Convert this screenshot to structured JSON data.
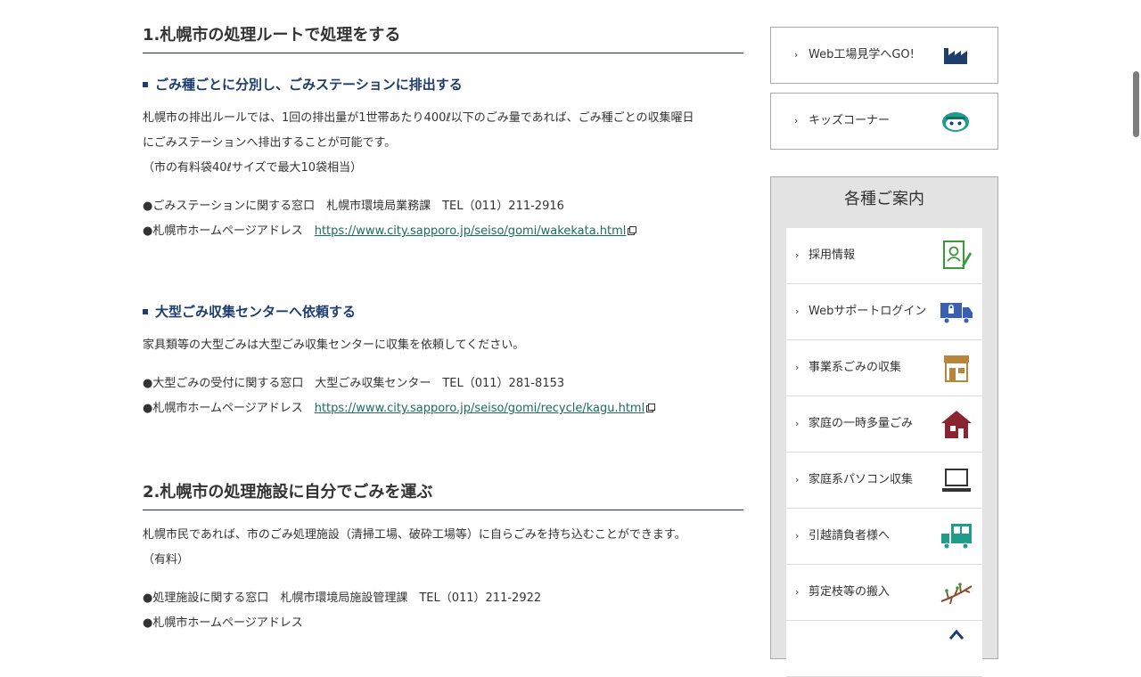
{
  "section1": {
    "heading": "1.札幌市の処理ルートで処理をする",
    "sub1": {
      "heading": "ごみ種ごとに分別し、ごみステーションに排出する",
      "body_line1": "札幌市の排出ルールでは、1回の排出量が1世帯あたり400ℓ以下のごみ量であれば、ごみ種ごとの収集曜日",
      "body_line2": "にごみステーションへ排出することが可能です。",
      "body_line3": "（市の有料袋40ℓサイズで最大10袋相当）",
      "contact": "●ごみステーションに関する窓口　札幌市環境局業務課　TEL（011）211-2916",
      "hp_label": "●札幌市ホームページアドレス　",
      "hp_link": "https://www.city.sapporo.jp/seiso/gomi/wakekata.html"
    },
    "sub2": {
      "heading": "大型ごみ収集センターへ依頼する",
      "body_line1": "家具類等の大型ごみは大型ごみ収集センターに収集を依頼してください。",
      "contact": "●大型ごみの受付に関する窓口　大型ごみ収集センター　TEL（011）281-8153",
      "hp_label": "●札幌市ホームページアドレス　",
      "hp_link": "https://www.city.sapporo.jp/seiso/gomi/recycle/kagu.html"
    }
  },
  "section2": {
    "heading": "2.札幌市の処理施設に自分でごみを運ぶ",
    "body_line1": "札幌市民であれば、市のごみ処理施設（清掃工場、破砕工場等）に自らごみを持ち込むことができます。",
    "body_line2": "（有料）",
    "contact": "●処理施設に関する窓口　札幌市環境局施設管理課　TEL（011）211-2922",
    "hp_label": "●札幌市ホームページアドレス"
  },
  "sidebar": {
    "banner1": {
      "label": "Web工場見学へGO!",
      "icon": "factory-icon"
    },
    "banner2": {
      "label": "キッズコーナー",
      "icon": "kids-mascot-icon"
    },
    "guide_title": "各種ご案内",
    "items": [
      {
        "label": "採用情報",
        "icon": "recruit-document-icon",
        "color": "#3a9a3a"
      },
      {
        "label": "Webサポートログイン",
        "icon": "truck-lock-icon",
        "color": "#3b5fb0"
      },
      {
        "label": "事業系ごみの収集",
        "icon": "store-icon",
        "color": "#b8863b"
      },
      {
        "label": "家庭の一時多量ごみ",
        "icon": "house-icon",
        "color": "#8a2430"
      },
      {
        "label": "家庭系パソコン収集",
        "icon": "laptop-icon",
        "color": "#333333"
      },
      {
        "label": "引越請負者様へ",
        "icon": "moving-truck-icon",
        "color": "#1f9c8a"
      },
      {
        "label": "剪定枝等の搬入",
        "icon": "branch-icon",
        "color": "#8a4a2a"
      }
    ]
  },
  "colors": {
    "heading_blue": "#1c3d6e",
    "link": "#1a6c5c",
    "guide_bg": "#e3e3e3"
  }
}
